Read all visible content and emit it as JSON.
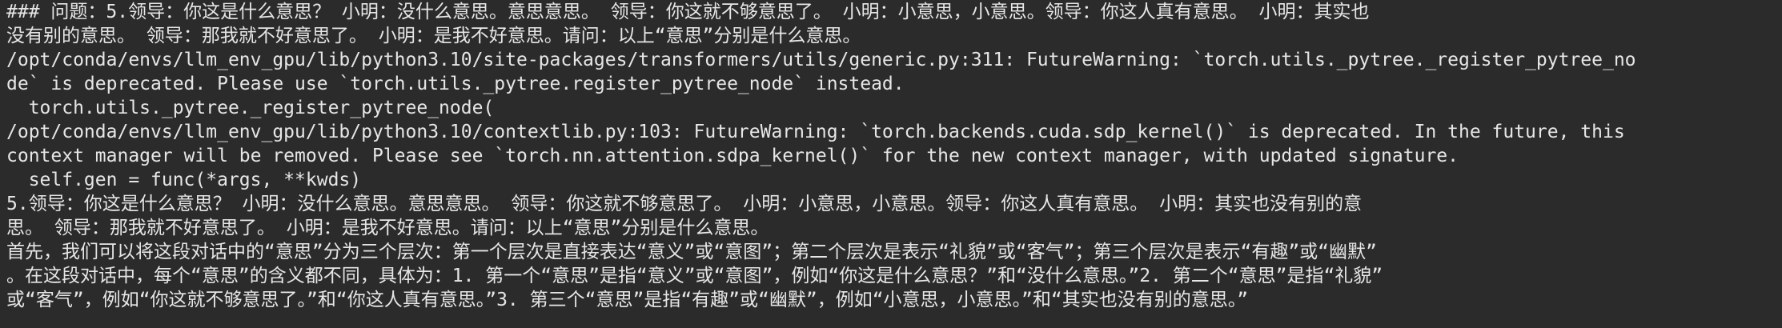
{
  "terminal": {
    "lines": [
      "### 问题：5.领导：你这是什么意思？ 小明：没什么意思。意思意思。 领导：你这就不够意思了。 小明：小意思，小意思。领导：你这人真有意思。 小明：其实也",
      "没有别的意思。 领导：那我就不好意思了。 小明：是我不好意思。请问：以上“意思”分别是什么意思。",
      "/opt/conda/envs/llm_env_gpu/lib/python3.10/site-packages/transformers/utils/generic.py:311: FutureWarning: `torch.utils._pytree._register_pytree_no",
      "de` is deprecated. Please use `torch.utils._pytree.register_pytree_node` instead.",
      "  torch.utils._pytree._register_pytree_node(",
      "/opt/conda/envs/llm_env_gpu/lib/python3.10/contextlib.py:103: FutureWarning: `torch.backends.cuda.sdp_kernel()` is deprecated. In the future, this",
      "context manager will be removed. Please see `torch.nn.attention.sdpa_kernel()` for the new context manager, with updated signature.",
      "  self.gen = func(*args, **kwds)",
      "5.领导：你这是什么意思？ 小明：没什么意思。意思意思。 领导：你这就不够意思了。 小明：小意思，小意思。领导：你这人真有意思。 小明：其实也没有别的意",
      "思。 领导：那我就不好意思了。 小明：是我不好意思。请问：以上“意思”分别是什么意思。",
      "首先，我们可以将这段对话中的“意思”分为三个层次：第一个层次是直接表达“意义”或“意图”；第二个层次是表示“礼貌”或“客气”；第三个层次是表示“有趣”或“幽默”",
      "。在这段对话中，每个“意思”的含义都不同，具体为：1. 第一个“意思”是指“意义”或“意图”，例如“你这是什么意思？”和“没什么意思。”2. 第二个“意思”是指“礼貌”",
      "或“客气”，例如“你这就不够意思了。”和“你这人真有意思。”3. 第三个“意思”是指“有趣”或“幽默”，例如“小意思，小意思。”和“其实也没有别的意思。”"
    ]
  }
}
